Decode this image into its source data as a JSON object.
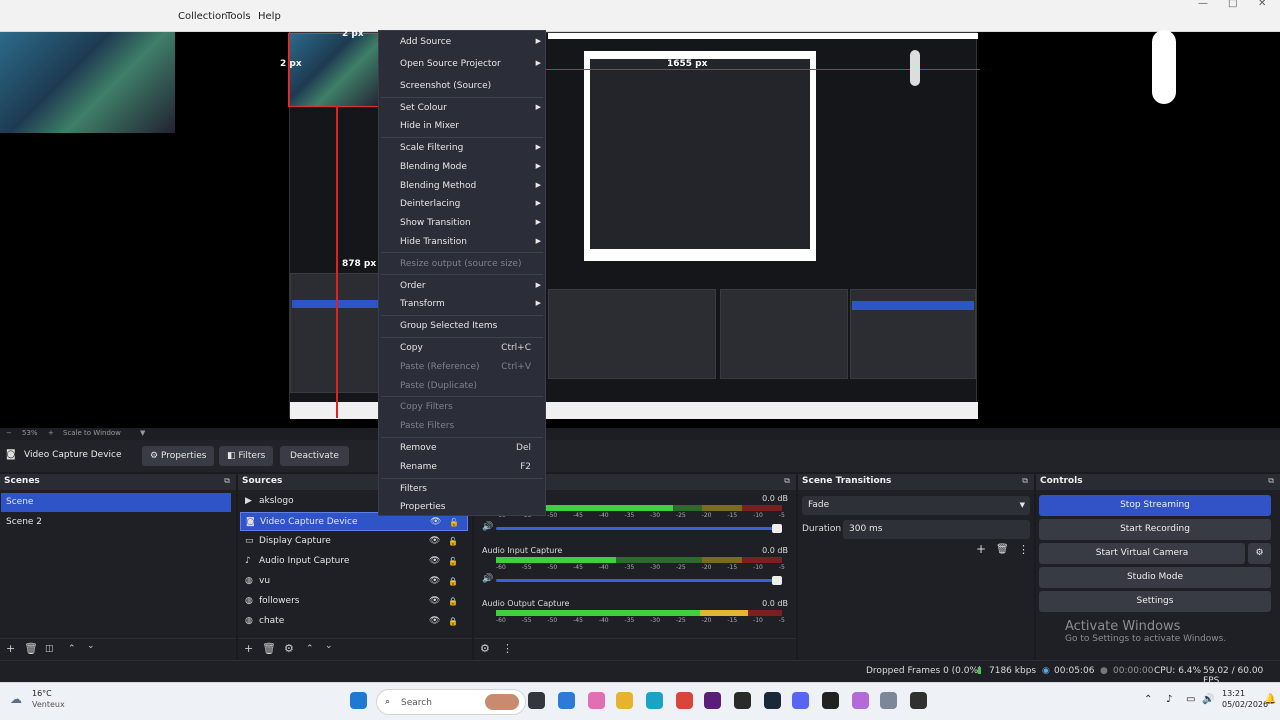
{
  "menubar": {
    "items": [
      "Collection",
      "Tools",
      "Help"
    ]
  },
  "preview": {
    "size_label_top": "2 px",
    "size_label_left": "2 px",
    "size_label_bottom": "878 px",
    "size_label_nested": "1655 px"
  },
  "context_menu": {
    "items": [
      {
        "label": "Add Source",
        "submenu": true
      },
      {
        "label": "Open Source Projector",
        "submenu": true
      },
      {
        "label": "Screenshot (Source)"
      },
      {
        "label": "Set Colour",
        "submenu": true
      },
      {
        "label": "Hide in Mixer"
      },
      {
        "label": "Scale Filtering",
        "submenu": true
      },
      {
        "label": "Blending Mode",
        "submenu": true
      },
      {
        "label": "Blending Method",
        "submenu": true
      },
      {
        "label": "Deinterlacing",
        "submenu": true
      },
      {
        "label": "Show Transition",
        "submenu": true
      },
      {
        "label": "Hide Transition",
        "submenu": true
      },
      {
        "label": "Resize output (source size)",
        "disabled": true
      },
      {
        "label": "Order",
        "submenu": true
      },
      {
        "label": "Transform",
        "submenu": true
      },
      {
        "label": "Group Selected Items"
      },
      {
        "label": "Copy",
        "shortcut": "Ctrl+C"
      },
      {
        "label": "Paste (Reference)",
        "shortcut": "Ctrl+V",
        "disabled": true
      },
      {
        "label": "Paste (Duplicate)",
        "disabled": true
      },
      {
        "label": "Copy Filters",
        "disabled": true
      },
      {
        "label": "Paste Filters",
        "disabled": true
      },
      {
        "label": "Remove",
        "shortcut": "Del"
      },
      {
        "label": "Rename",
        "shortcut": "F2"
      },
      {
        "label": "Filters"
      },
      {
        "label": "Properties"
      }
    ]
  },
  "zoombar": {
    "zoom": "53%",
    "scale_label": "Scale to Window"
  },
  "source_toolbar": {
    "source_name": "Video Capture Device",
    "properties": "Properties",
    "filters": "Filters",
    "deactivate": "Deactivate"
  },
  "scenes": {
    "title": "Scenes",
    "items": [
      "Scene",
      "Scene 2"
    ],
    "selected": "Scene"
  },
  "sources": {
    "title": "Sources",
    "items": [
      {
        "name": "akslogo",
        "icon": "play-icon"
      },
      {
        "name": "Video Capture Device",
        "icon": "camera-icon",
        "selected": true
      },
      {
        "name": "Display Capture",
        "icon": "monitor-icon"
      },
      {
        "name": "Audio Input Capture",
        "icon": "mic-icon"
      },
      {
        "name": "vu",
        "icon": "globe-icon"
      },
      {
        "name": "followers",
        "icon": "globe-icon"
      },
      {
        "name": "chate",
        "icon": "globe-icon"
      }
    ]
  },
  "mixer": {
    "channels": [
      {
        "name": "",
        "db": "0.0 dB",
        "level": 0.62
      },
      {
        "name": "Audio Input Capture",
        "db": "0.0 dB",
        "level": 0.42
      },
      {
        "name": "Audio Output Capture",
        "db": "0.0 dB",
        "level": 0.88
      }
    ],
    "scale": "-60 -55 -50 -45 -40 -35 -30 -25 -20 -15 -10 -5 0"
  },
  "transitions": {
    "title": "Scene Transitions",
    "selected": "Fade",
    "duration_label": "Duration",
    "duration_value": "300 ms"
  },
  "controls": {
    "title": "Controls",
    "stop_streaming": "Stop Streaming",
    "start_recording": "Start Recording",
    "start_virtual_camera": "Start Virtual Camera",
    "studio_mode": "Studio Mode",
    "settings": "Settings"
  },
  "activate_windows": {
    "title": "Activate Windows",
    "subtitle": "Go to Settings to activate Windows."
  },
  "status": {
    "dropped_frames": "Dropped Frames 0 (0.0%)",
    "bitrate": "7186 kbps",
    "stream_time": "00:05:06",
    "rec_time": "00:00:00",
    "cpu": "CPU: 6.4%",
    "fps": "59.02 / 60.00 FPS"
  },
  "taskbar": {
    "weather_temp": "16°C",
    "weather_desc": "Venteux",
    "search_placeholder": "Search",
    "time": "13:21",
    "date": "05/02/2026"
  }
}
